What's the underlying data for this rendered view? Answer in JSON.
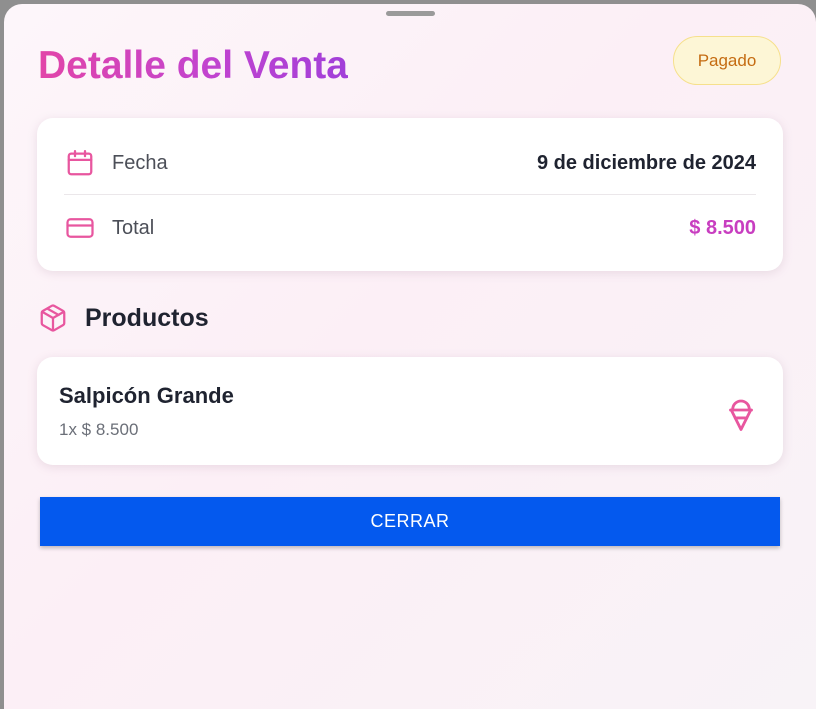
{
  "dialog": {
    "title": "Detalle del Venta",
    "status": "Pagado"
  },
  "info": {
    "date_label": "Fecha",
    "date_value": "9 de diciembre de 2024",
    "total_label": "Total",
    "total_value": "$ 8.500"
  },
  "products": {
    "title": "Productos",
    "items": [
      {
        "name": "Salpicón Grande",
        "quantity_price": "1x $ 8.500",
        "icon": "ice-cream-icon"
      }
    ]
  },
  "actions": {
    "close_label": "CERRAR"
  },
  "icons": {
    "date": "calendar-icon",
    "total": "credit-card-icon",
    "products": "package-icon"
  },
  "colors": {
    "accent_pink": "#e8569f",
    "title_gradient_start": "#e245a8",
    "title_gradient_end": "#a13fd9",
    "total_amount": "#c83ec0",
    "status_text": "#c56c12",
    "status_bg": "#fdf6d6",
    "primary_button": "#0459ee"
  }
}
